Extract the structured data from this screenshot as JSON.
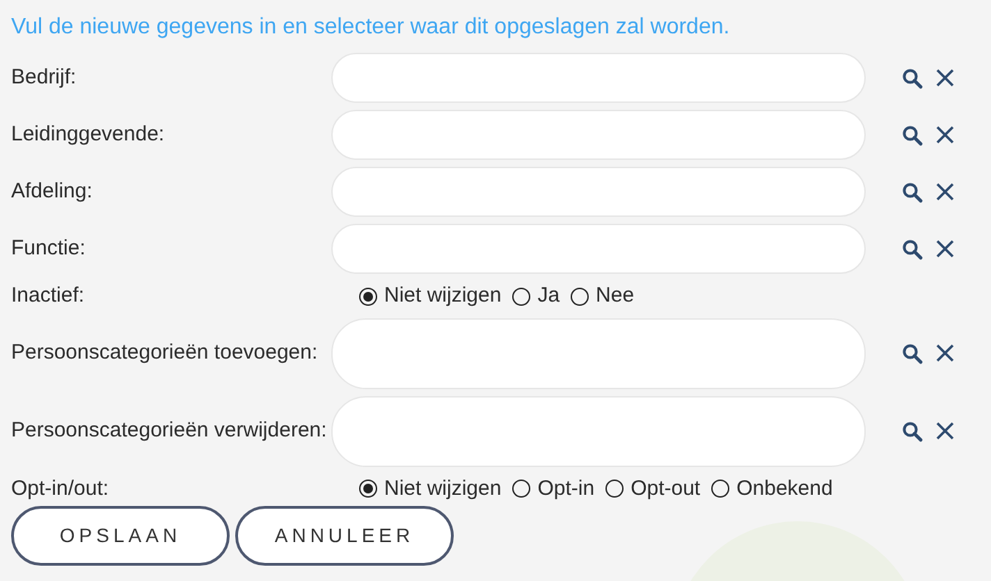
{
  "intro": "Vul de nieuwe gegevens in en selecteer waar dit opgeslagen zal worden.",
  "rows": [
    {
      "kind": "lookup",
      "label": "Bedrijf:"
    },
    {
      "kind": "lookup",
      "label": "Leidinggevende:"
    },
    {
      "kind": "lookup",
      "label": "Afdeling:"
    },
    {
      "kind": "lookup",
      "label": "Functie:"
    },
    {
      "kind": "radios",
      "label": "Inactief:",
      "options": [
        {
          "label": "Niet wijzigen",
          "selected": true
        },
        {
          "label": "Ja",
          "selected": false
        },
        {
          "label": "Nee",
          "selected": false
        }
      ]
    },
    {
      "kind": "tall-lookup",
      "label": "Persoonscategorieën toevoegen:"
    },
    {
      "kind": "tall-lookup",
      "label": "Persoonscategorieën verwijderen:"
    },
    {
      "kind": "radios",
      "label": "Opt-in/out:",
      "options": [
        {
          "label": "Niet wijzigen",
          "selected": true
        },
        {
          "label": "Opt-in",
          "selected": false
        },
        {
          "label": "Opt-out",
          "selected": false
        },
        {
          "label": "Onbekend",
          "selected": false
        }
      ]
    }
  ],
  "buttons": [
    "OPSLAAN",
    "ANNULEER"
  ]
}
